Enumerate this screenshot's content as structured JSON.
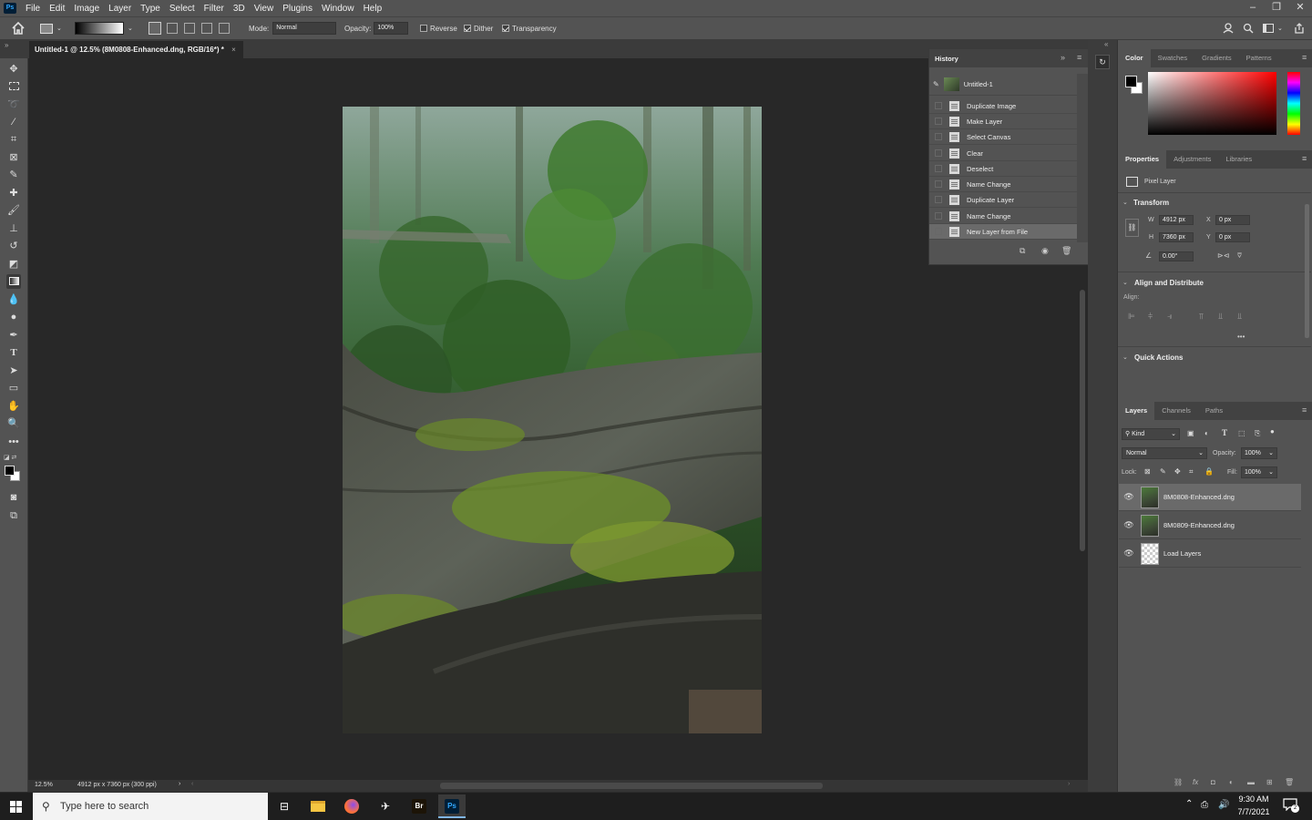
{
  "app": {
    "icon_label": "Ps",
    "menu": [
      "File",
      "Edit",
      "Image",
      "Layer",
      "Type",
      "Select",
      "Filter",
      "3D",
      "View",
      "Plugins",
      "Window",
      "Help"
    ],
    "window_controls": {
      "minimize": "–",
      "restore": "❐",
      "close": "✕"
    }
  },
  "options_bar": {
    "mode_label": "Mode:",
    "mode_value": "Normal",
    "opacity_label": "Opacity:",
    "opacity_value": "100%",
    "reverse_label": "Reverse",
    "dither_label": "Dither",
    "transparency_label": "Transparency"
  },
  "document": {
    "tab_title": "Untitled-1 @ 12.5% (8M0808-Enhanced.dng, RGB/16*) *",
    "tab_close": "×",
    "zoom": "12.5%",
    "doc_info": "4912 px x 7360 px (300 ppi)"
  },
  "history": {
    "title": "History",
    "snapshot": "Untitled-1",
    "items": [
      "Duplicate Image",
      "Make Layer",
      "Select Canvas",
      "Clear",
      "Deselect",
      "Name Change",
      "Duplicate Layer",
      "Name Change",
      "New Layer from File"
    ]
  },
  "color_panel": {
    "tabs": [
      "Color",
      "Swatches",
      "Gradients",
      "Patterns"
    ],
    "foreground": "#000000",
    "background": "#ffffff"
  },
  "properties": {
    "tabs": [
      "Properties",
      "Adjustments",
      "Libraries"
    ],
    "layer_type": "Pixel Layer",
    "transform_title": "Transform",
    "w_label": "W",
    "w_value": "4912 px",
    "h_label": "H",
    "h_value": "7360 px",
    "x_label": "X",
    "x_value": "0 px",
    "y_label": "Y",
    "y_value": "0 px",
    "angle_value": "0.00°",
    "align_title": "Align and Distribute",
    "align_label": "Align:",
    "more": "•••",
    "quick_actions_title": "Quick Actions"
  },
  "layers": {
    "tabs": [
      "Layers",
      "Channels",
      "Paths"
    ],
    "filter_label": "Kind",
    "blend_mode": "Normal",
    "opacity_label": "Opacity:",
    "opacity_value": "100%",
    "lock_label": "Lock:",
    "fill_label": "Fill:",
    "fill_value": "100%",
    "items": [
      {
        "name": "8M0808-Enhanced.dng"
      },
      {
        "name": "8M0809-Enhanced.dng"
      },
      {
        "name": "Load Layers"
      }
    ]
  },
  "taskbar": {
    "search_placeholder": "Type here to search",
    "time": "9:30 AM",
    "date": "7/7/2021",
    "notification_count": "2",
    "bridge_label": "Br",
    "ps_label": "Ps"
  }
}
